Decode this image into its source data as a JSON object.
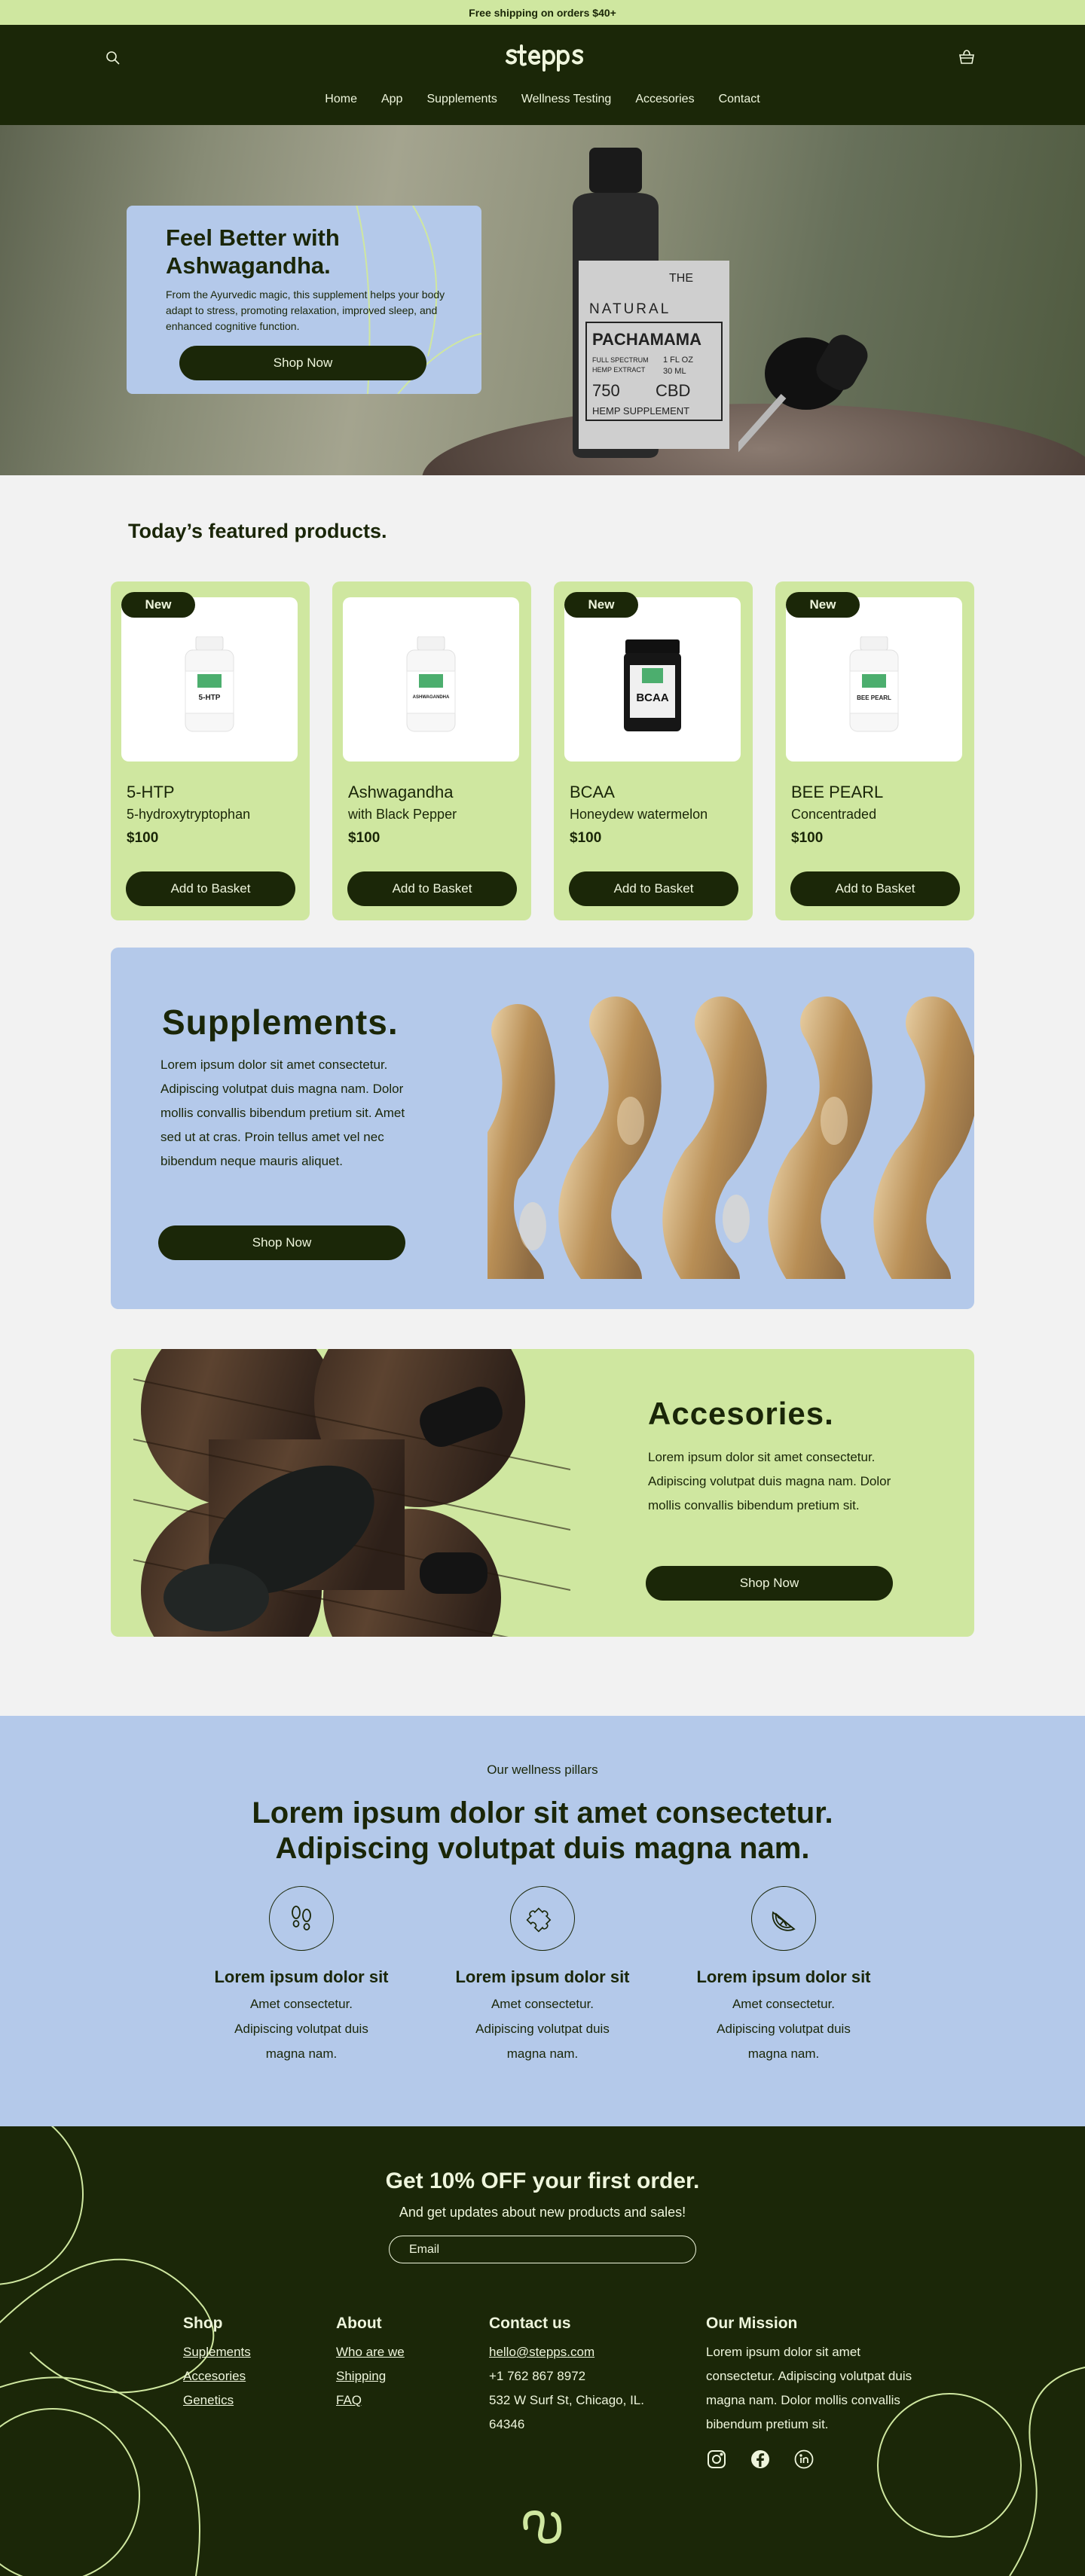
{
  "announcement": "Free shipping on orders $40+",
  "brand": {
    "name": "stepps",
    "accent_dark": "#1b2708",
    "accent_green": "#cfe7a0",
    "accent_blue": "#b4c9ea"
  },
  "nav": [
    "Home",
    "App",
    "Supplements",
    "Wellness Testing",
    "Accesories",
    "Contact"
  ],
  "icons": {
    "search": "search-icon",
    "bag": "shopping-bag-icon"
  },
  "hero": {
    "title_line1": "Feel Better with",
    "title_line2": "Ashwagandha.",
    "text": "From the Ayurvedic magic, this supplement helps your body adapt to stress, promoting relaxation, improved sleep, and enhanced cognitive function.",
    "button": "Shop Now",
    "bottle_label": {
      "brand": "PACHAMAMA",
      "top": "THE",
      "mid": "NATURAL",
      "l1": "FULL SPECTRUM",
      "l2": "HEMP EXTRACT",
      "l3": "1 FL OZ",
      "l4": "30 ML",
      "mg": "750",
      "cbd": "CBD",
      "foot": "HEMP SUPPLEMENT"
    }
  },
  "featured": {
    "title": "Today’s featured products.",
    "products": [
      {
        "badge": "New",
        "name": "5-HTP",
        "subtitle": "5-hydroxytryptophan",
        "price": "$100",
        "button": "Add to Basket",
        "label": "5-HTP",
        "jar": "white"
      },
      {
        "badge": "",
        "name": "Ashwagandha",
        "subtitle": "with Black Pepper",
        "price": "$100",
        "button": "Add to Basket",
        "label": "ASHWAGANDHA",
        "jar": "white"
      },
      {
        "badge": "New",
        "name": "BCAA",
        "subtitle": "Honeydew watermelon",
        "price": "$100",
        "button": "Add to Basket",
        "label": "BCAA",
        "jar": "black"
      },
      {
        "badge": "New",
        "name": "BEE PEARL",
        "subtitle": "Concentraded",
        "price": "$100",
        "button": "Add to Basket",
        "label": "BEE PEARL",
        "jar": "white"
      }
    ]
  },
  "supplements": {
    "title": "Supplements.",
    "text": "Lorem ipsum dolor sit amet consectetur. Adipiscing volutpat duis magna nam. Dolor mollis convallis bibendum pretium sit. Amet sed ut at cras. Proin tellus amet vel nec bibendum neque mauris aliquet.",
    "button": "Shop Now"
  },
  "accessories": {
    "title": "Accesories.",
    "text": "Lorem ipsum dolor sit amet consectetur. Adipiscing volutpat duis magna nam. Dolor mollis convallis bibendum pretium sit.",
    "button": "Shop Now"
  },
  "pillars": {
    "kicker": "Our wellness pillars",
    "heading_line1": "Lorem ipsum dolor sit amet consectetur.",
    "heading_line2": "Adipiscing volutpat duis magna nam.",
    "items": [
      {
        "icon": "footprints-icon",
        "title": "Lorem ipsum dolor sit",
        "text": "Amet consectetur. Adipiscing volutpat duis magna nam."
      },
      {
        "icon": "puzzle-icon",
        "title": "Lorem ipsum dolor sit",
        "text": "Amet consectetur. Adipiscing volutpat duis magna nam."
      },
      {
        "icon": "lime-slice-icon",
        "title": "Lorem ipsum dolor sit",
        "text": "Amet consectetur. Adipiscing volutpat duis magna nam."
      }
    ]
  },
  "footer": {
    "promo_title": "Get 10% OFF your first order.",
    "promo_sub": "And get updates about new products and sales!",
    "email_placeholder": "Email",
    "shop": {
      "title": "Shop",
      "links": [
        "Suplements",
        "Accesories",
        "Genetics"
      ]
    },
    "about": {
      "title": "About",
      "links": [
        "Who are we",
        "Shipping",
        "FAQ"
      ]
    },
    "contact": {
      "title": "Contact us",
      "email": "hello@stepps.com",
      "phone": "+1 762 867 8972",
      "address_line1": "532 W Surf St, Chicago, IL.",
      "address_line2": "64346"
    },
    "mission": {
      "title": "Our Mission",
      "text": "Lorem ipsum dolor sit amet consectetur. Adipiscing volutpat duis magna nam. Dolor mollis convallis bibendum pretium sit."
    },
    "social": [
      "instagram-icon",
      "facebook-icon",
      "linkedin-icon"
    ]
  }
}
